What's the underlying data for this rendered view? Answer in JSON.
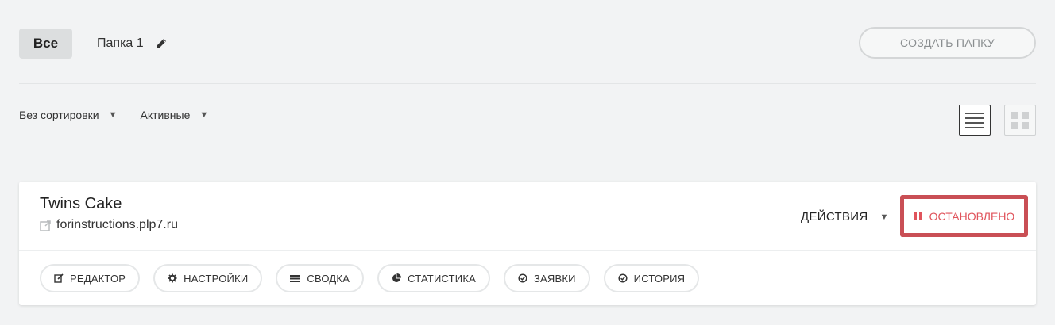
{
  "folders": {
    "all_label": "Все",
    "folder1_label": "Папка 1",
    "edit_icon": "pencil-icon"
  },
  "create_folder_label": "СОЗДАТЬ ПАПКУ",
  "filters": {
    "sort_label": "Без сортировки",
    "status_label": "Активные"
  },
  "view": {
    "list_icon": "list-view-icon",
    "grid_icon": "grid-view-icon",
    "active": "list"
  },
  "site": {
    "name": "Twins Cake",
    "url": "forinstructions.plp7.ru",
    "actions_label": "ДЕЙСТВИЯ",
    "status_label": "ОСТАНОВЛЕНО"
  },
  "tools": [
    {
      "label": "РЕДАКТОР",
      "icon": "edit-icon"
    },
    {
      "label": "НАСТРОЙКИ",
      "icon": "gear-icon"
    },
    {
      "label": "СВОДКА",
      "icon": "list-icon"
    },
    {
      "label": "СТАТИСТИКА",
      "icon": "pie-chart-icon"
    },
    {
      "label": "ЗАЯВКИ",
      "icon": "check-circle-icon"
    },
    {
      "label": "ИСТОРИЯ",
      "icon": "check-circle-icon"
    }
  ],
  "colors": {
    "background": "#f2f3f4",
    "status_red": "#e0545c",
    "status_border": "#c94f55"
  }
}
